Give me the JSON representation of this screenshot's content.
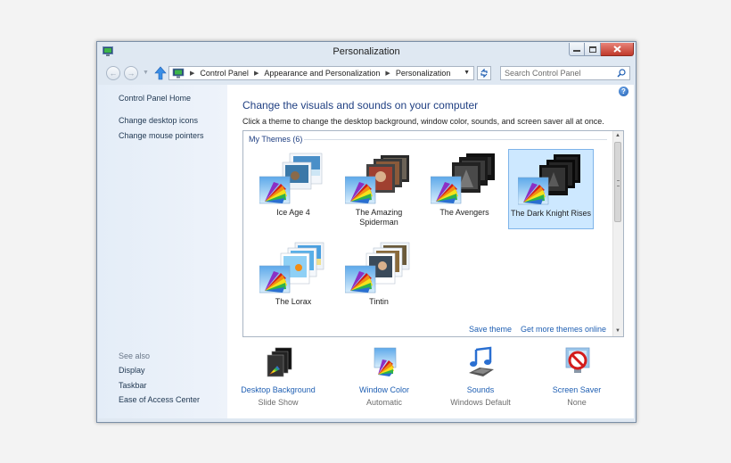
{
  "window": {
    "title": "Personalization"
  },
  "address": {
    "crumbs": [
      "Control Panel",
      "Appearance and Personalization",
      "Personalization"
    ],
    "search_placeholder": "Search Control Panel"
  },
  "sidebar": {
    "links": [
      "Control Panel Home",
      "Change desktop icons",
      "Change mouse pointers"
    ],
    "see_also_label": "See also",
    "see_also": [
      "Display",
      "Taskbar",
      "Ease of Access Center"
    ]
  },
  "main": {
    "help": "?",
    "heading": "Change the visuals and sounds on your computer",
    "subtext": "Click a theme to change the desktop background, window color, sounds, and screen saver all at once.",
    "group_label": "My Themes (6)",
    "themes": [
      {
        "name": "Ice Age 4",
        "selected": false
      },
      {
        "name": "The Amazing Spiderman",
        "selected": false
      },
      {
        "name": "The Avengers",
        "selected": false
      },
      {
        "name": "The Dark Knight Rises",
        "selected": true
      },
      {
        "name": "The Lorax",
        "selected": false
      },
      {
        "name": "Tintin",
        "selected": false
      }
    ],
    "save_theme": "Save theme",
    "more_themes": "Get more themes online",
    "bottom": [
      {
        "label": "Desktop Background",
        "value": "Slide Show",
        "icon": "desktop-background-icon"
      },
      {
        "label": "Window Color",
        "value": "Automatic",
        "icon": "window-color-icon"
      },
      {
        "label": "Sounds",
        "value": "Windows Default",
        "icon": "sounds-icon"
      },
      {
        "label": "Screen Saver",
        "value": "None",
        "icon": "screen-saver-icon"
      }
    ]
  },
  "colors": {
    "link": "#1f5fb3",
    "heading": "#1f3f82",
    "selected_bg": "#cde8ff",
    "selected_border": "#7eb4ea"
  }
}
